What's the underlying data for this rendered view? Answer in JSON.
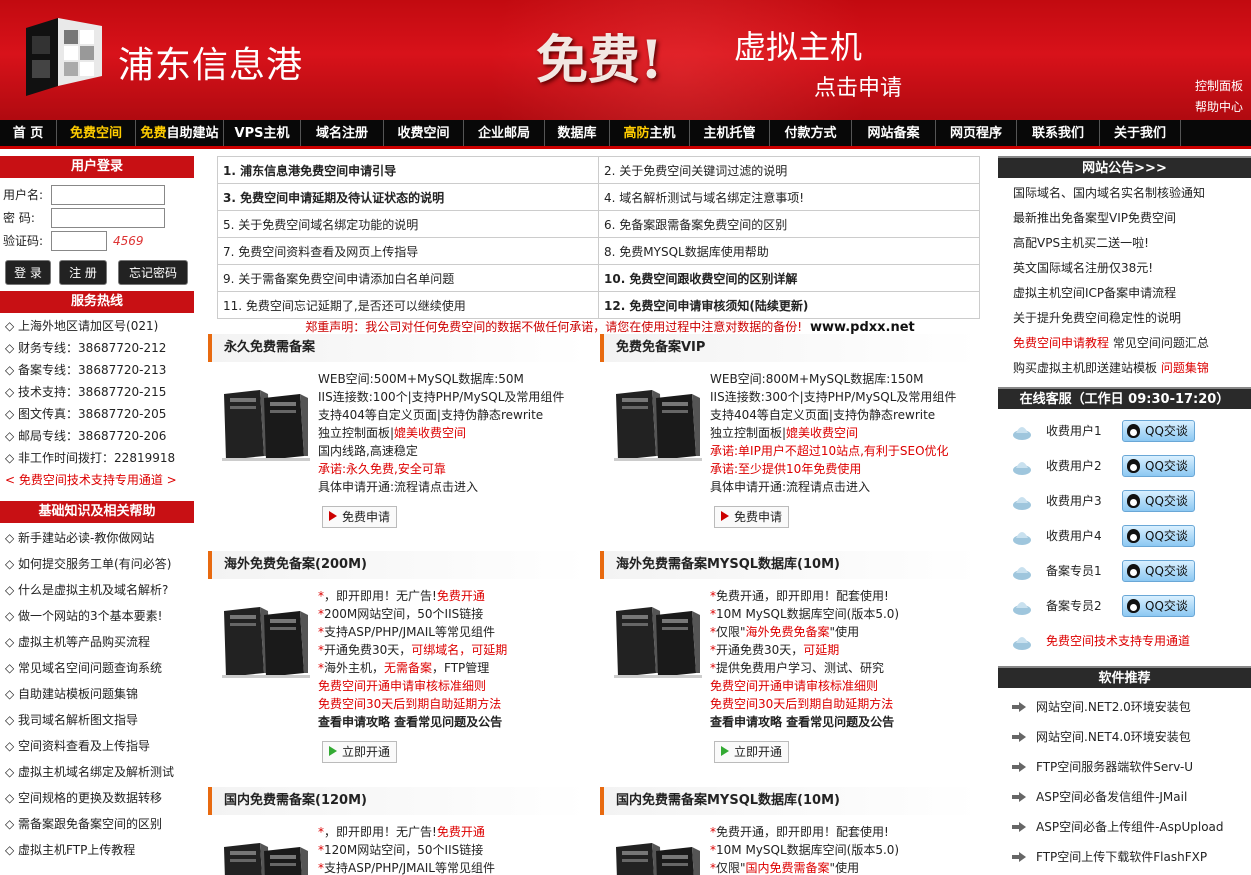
{
  "header": {
    "site_name": "浦东信息港",
    "promo_free": "免费!",
    "promo_host": "虚拟主机",
    "promo_apply": "点击申请",
    "control_panel": "控制面板",
    "help_center": "帮助中心"
  },
  "nav": [
    {
      "label": "首  页",
      "highlight": ""
    },
    {
      "label": "免费空间",
      "highlight": "all"
    },
    {
      "label": "自助建站",
      "prefix": "免费"
    },
    {
      "label": "VPS主机",
      "highlight": ""
    },
    {
      "label": "域名注册",
      "highlight": ""
    },
    {
      "label": "收费空间",
      "highlight": ""
    },
    {
      "label": "企业邮局",
      "highlight": ""
    },
    {
      "label": "数据库",
      "highlight": ""
    },
    {
      "label": "主机",
      "prefix": "高防"
    },
    {
      "label": "主机托管",
      "highlight": ""
    },
    {
      "label": "付款方式",
      "highlight": ""
    },
    {
      "label": "网站备案",
      "highlight": ""
    },
    {
      "label": "网页程序",
      "highlight": ""
    },
    {
      "label": "联系我们",
      "highlight": ""
    },
    {
      "label": "关于我们",
      "highlight": ""
    }
  ],
  "login": {
    "title": "用户登录",
    "username_label": "用户名:",
    "password_label": "密  码:",
    "captcha_label": "验证码:",
    "captcha_text": "4569",
    "login_btn": "登 录",
    "register_btn": "注 册",
    "forgot_btn": "忘记密码"
  },
  "service": {
    "title": "服务热线",
    "items": [
      "◇ 上海外地区请加区号(021)",
      "◇ 财务专线：38687720-212",
      "◇ 备案专线：38687720-213",
      "◇ 技术支持：38687720-215",
      "◇ 图文传真：38687720-205",
      "◇ 邮局专线：38687720-206",
      "◇ 非工作时间拨打：22819918"
    ],
    "tech_channel": "< 免费空间技术支持专用通道 >"
  },
  "knowledge": {
    "title": "基础知识及相关帮助",
    "items": [
      "◇ 新手建站必读-教你做网站",
      "◇ 如何提交服务工单(有问必答)",
      "◇ 什么是虚拟主机及域名解析?",
      "◇ 做一个网站的3个基本要素!",
      "◇ 虚拟主机等产品购买流程",
      "◇ 常见域名空间问题查询系统",
      "◇ 自助建站模板问题集锦",
      "◇ 我司域名解析图文指导",
      "◇ 空间资料查看及上传指导",
      "◇ 虚拟主机域名绑定及解析测试",
      "◇ 空间规格的更换及数据转移",
      "◇ 需备案跟免备案空间的区别",
      "◇ 虚拟主机FTP上传教程"
    ]
  },
  "articles": [
    [
      "1. 浦东信息港免费空间申请引导",
      "2. 关于免费空间关键词过滤的说明"
    ],
    [
      "3. 免费空间申请延期及待认证状态的说明",
      "4. 域名解析测试与域名绑定注意事项!"
    ],
    [
      "5. 关于免费空间域名绑定功能的说明",
      "6. 免备案跟需备案免费空间的区别"
    ],
    [
      "7. 免费空间资料查看及网页上传指导",
      "8. 免费MYSQL数据库使用帮助"
    ],
    [
      "9. 关于需备案免费空间申请添加白名单问题",
      "10. 免费空间跟收费空间的区别详解"
    ],
    [
      "11. 免费空间忘记延期了,是否还可以继续使用",
      "12. 免费空间申请审核须知(陆续更新)"
    ]
  ],
  "articles_bold": [
    [
      true,
      false
    ],
    [
      true,
      false
    ],
    [
      false,
      false
    ],
    [
      false,
      false
    ],
    [
      false,
      true
    ],
    [
      false,
      true
    ]
  ],
  "disclaimer": "郑重声明：我公司对任何免费空间的数据不做任何承诺，请您在使用过程中注意对数据的备份!",
  "disclaimer_site": "www.pdxx.net",
  "plans": [
    {
      "title": "永久免费需备案",
      "lines": [
        {
          "t": "WEB空间:500M+MySQL数据库:50M"
        },
        {
          "t": "IIS连接数:100个|支持PHP/MySQL及常用组件"
        },
        {
          "t": "支持404等自定义页面|支持伪静态rewrite"
        },
        {
          "t": "独立控制面板|",
          "r": "媲美收费空间"
        },
        {
          "t": "国内线路,高速稳定"
        },
        {
          "r": "承诺:永久免费,安全可靠"
        },
        {
          "t": "具体申请开通:流程请点击进入"
        }
      ],
      "button": "免费申请"
    },
    {
      "title": "免费免备案VIP",
      "lines": [
        {
          "t": "WEB空间:800M+MySQL数据库:150M"
        },
        {
          "t": "IIS连接数:300个|支持PHP/MySQL及常用组件"
        },
        {
          "t": "支持404等自定义页面|支持伪静态rewrite"
        },
        {
          "t": "独立控制面板|",
          "r": "媲美收费空间"
        },
        {
          "r": "承诺:单IP用户不超过10站点,有利于SEO优化"
        },
        {
          "r": "承诺:至少提供10年免费使用"
        },
        {
          "t": "具体申请开通:流程请点击进入"
        }
      ],
      "button": "免费申请"
    },
    {
      "title": "海外免费免备案(200M)",
      "lines": [
        {
          "rs": "*",
          "r": "免费开通",
          "t": "，即开即用！无广告!"
        },
        {
          "rs": "*",
          "t": "200M网站空间，50个IIS链接"
        },
        {
          "rs": "*",
          "t": "支持ASP/PHP/JMAIL等常见组件"
        },
        {
          "rs": "*",
          "t": "开通免费30天，",
          "r": "可绑域名，可延期"
        },
        {
          "rs": "*",
          "t": "海外主机，",
          "r": "无需备案",
          "t2": "，FTP管理"
        },
        {
          "r": "免费空间开通申请审核标准细则"
        },
        {
          "r": "免费空间30天后到期自助延期方法"
        },
        {
          "k": "查看申请攻略 查看常见问题及公告"
        }
      ],
      "button": "立即开通"
    },
    {
      "title": "海外免费需备案MYSQL数据库(10M)",
      "lines": [
        {
          "rs": "*",
          "t": "免费开通，即开即用！配套使用!"
        },
        {
          "rs": "*",
          "t": "10M MySQL数据库空间(版本5.0)"
        },
        {
          "rs": "*",
          "t": "仅限\"",
          "r": "海外免费免备案",
          "t2": "\"使用"
        },
        {
          "rs": "*",
          "t": "开通免费30天，",
          "r": "可延期"
        },
        {
          "rs": "*",
          "t": "提供免费用户学习、测试、研究"
        },
        {
          "r": "免费空间开通申请审核标准细则"
        },
        {
          "r": "免费空间30天后到期自助延期方法"
        },
        {
          "k": "查看申请攻略 查看常见问题及公告"
        }
      ],
      "button": "立即开通"
    },
    {
      "title": "国内免费需备案(120M)",
      "lines": [
        {
          "rs": "*",
          "r": "免费开通",
          "t": "，即开即用！无广告!"
        },
        {
          "rs": "*",
          "t": "120M网站空间，50个IIS链接"
        },
        {
          "rs": "*",
          "t": "支持ASP/PHP/JMAIL等常见组件"
        }
      ],
      "button": ""
    },
    {
      "title": "国内免费需备案MYSQL数据库(10M)",
      "lines": [
        {
          "rs": "*",
          "t": "免费开通，即开即用！配套使用!"
        },
        {
          "rs": "*",
          "t": "10M MySQL数据库空间(版本5.0)"
        },
        {
          "rs": "*",
          "t": "仅限\"",
          "r": "国内免费需备案",
          "t2": "\"使用"
        }
      ],
      "button": ""
    }
  ],
  "announcements": {
    "title": "网站公告>>>",
    "items": [
      {
        "t": "国际域名、国内域名实名制核验通知"
      },
      {
        "t": "最新推出免备案型VIP免费空间"
      },
      {
        "t": "高配VPS主机买二送一啦!"
      },
      {
        "t": "英文国际域名注册仅38元!"
      },
      {
        "t": "虚拟主机空间ICP备案申请流程"
      },
      {
        "t": "关于提升免费空间稳定性的说明"
      },
      {
        "r": "免费空间申请教程",
        "t2": " 常见空间问题汇总"
      },
      {
        "t": "购买虚拟主机即送建站模板 ",
        "r2": "问题集锦"
      }
    ]
  },
  "support": {
    "title": "在线客服（工作日 09:30-17:20）",
    "rows": [
      "收费用户1",
      "收费用户2",
      "收费用户3",
      "收费用户4",
      "备案专员1",
      "备案专员2"
    ],
    "qq_label": "QQ交谈",
    "channel": "免费空间技术支持专用通道"
  },
  "software": {
    "title": "软件推荐",
    "items": [
      "网站空间.NET2.0环境安装包",
      "网站空间.NET4.0环境安装包",
      "FTP空间服务器端软件Serv-U",
      "ASP空间必备发信组件-JMail",
      "ASP空间必备上传组件-AspUpload",
      "FTP空间上传下载软件FlashFXP"
    ]
  },
  "colors": {
    "brand_red": "#c81014",
    "nav_bg": "#080808",
    "highlight": "#ffcc00",
    "accent_orange": "#e86a10"
  }
}
